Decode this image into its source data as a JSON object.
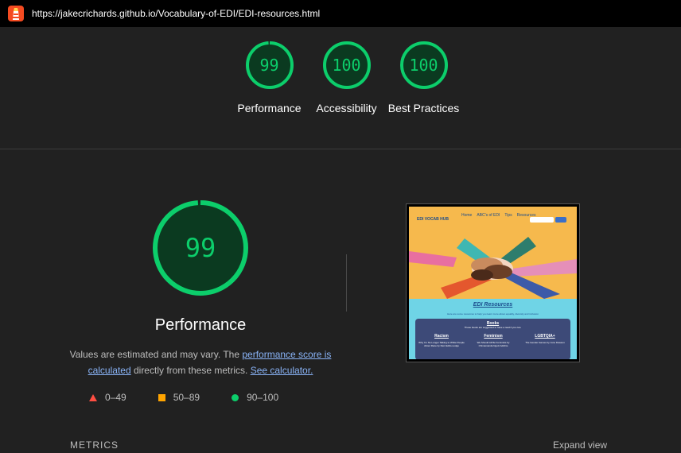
{
  "browser": {
    "url": "https://jakecrichards.github.io/Vocabulary-of-EDI/EDI-resources.html",
    "logo_icon": "lighthouse-icon"
  },
  "colors": {
    "pass": "#0cce6b",
    "average": "#ffa400",
    "fail": "#ff4e42",
    "link": "#8ab4f8"
  },
  "categories": [
    {
      "score": "99",
      "label": "Performance",
      "value": 0.99
    },
    {
      "score": "100",
      "label": "Accessibility",
      "value": 1.0
    },
    {
      "score": "100",
      "label": "Best Practices",
      "value": 1.0
    }
  ],
  "performance": {
    "score": "99",
    "value": 0.99,
    "title": "Performance",
    "note_prefix": "Values are estimated and may vary. The ",
    "note_link1": "performance score is calculated",
    "note_mid": " directly from these metrics. ",
    "note_link2": "See calculator."
  },
  "legend": [
    {
      "icon": "triangle-icon",
      "range": "0–49"
    },
    {
      "icon": "square-icon",
      "range": "50–89"
    },
    {
      "icon": "circle-icon",
      "range": "90–100"
    }
  ],
  "screenshot": {
    "brand": "EDI VOCAB HUB",
    "menu": [
      "Home",
      "ABC's of EDI",
      "Tips",
      "Resources"
    ],
    "heading": "EDI Resources",
    "subtext": "Here are some resources to help you learn more about equality, diversity and inclusion",
    "books_title": "Books",
    "books_sub": "These books are suggested to have a read if you can.",
    "columns": [
      {
        "title": "Racism",
        "item": "Why I'm No Longer Talking to White People About Race by Reni Eddo-Lodge"
      },
      {
        "title": "Feminism",
        "item": "We Should All Be Feminists by Chimamanda Ngozi Adichie"
      },
      {
        "title": "LGBTQIA+",
        "item": "The Gender Games by Juno Dawson"
      }
    ]
  },
  "footer": {
    "metrics_label": "METRICS",
    "expand_label": "Expand view"
  }
}
